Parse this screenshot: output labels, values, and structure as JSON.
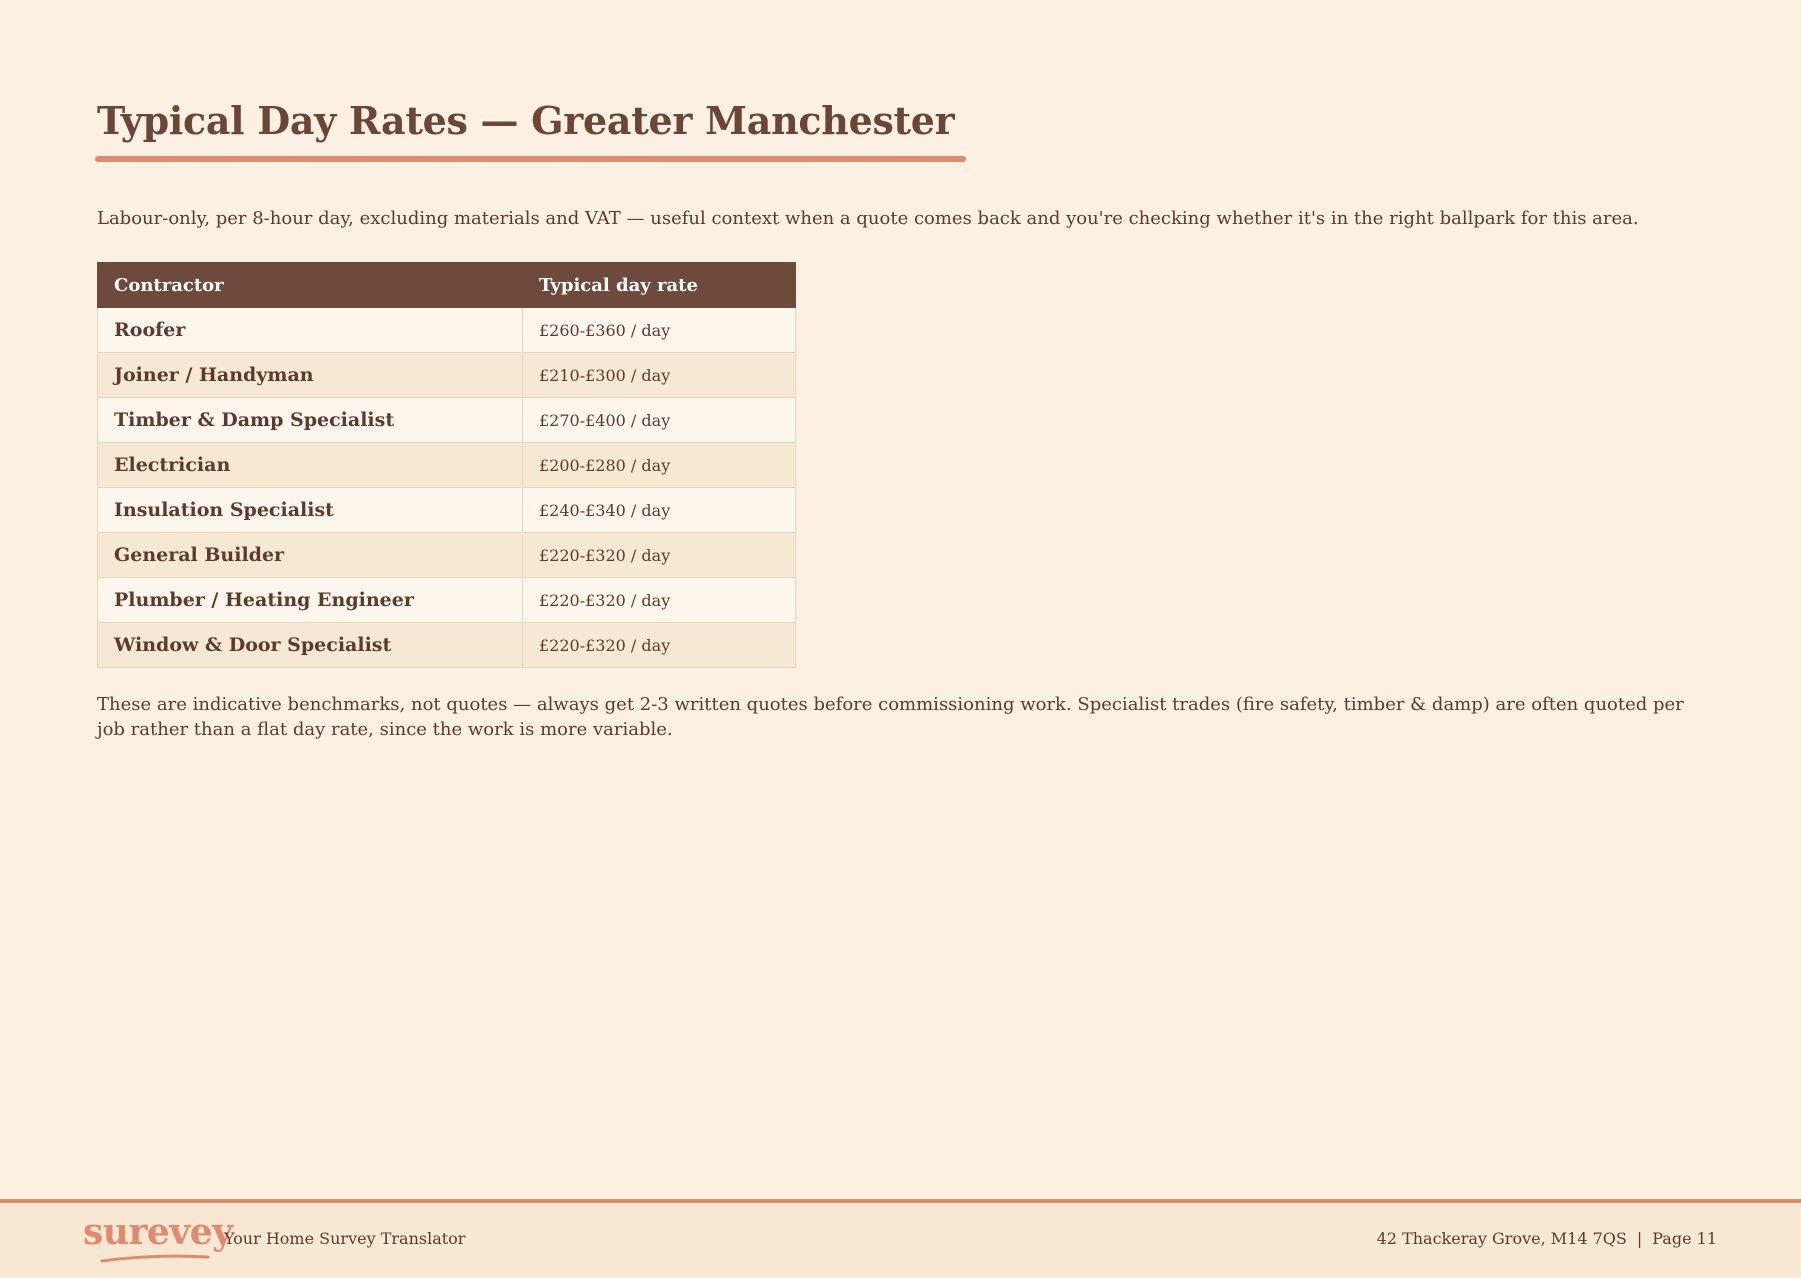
{
  "page": {
    "title": "Typical Day Rates — Greater Manchester",
    "intro": "Labour-only, per 8-hour day, excluding materials and VAT — useful context when a quote comes back and you're checking whether it's in the right ballpark for this area.",
    "note": "These are indicative benchmarks, not quotes — always get 2-3 written quotes before commissioning work. Specialist trades (fire safety, timber & damp) are often quoted per job rather than a flat day rate, since the work is more variable."
  },
  "table": {
    "headers": [
      "Contractor",
      "Typical day rate"
    ],
    "rows": [
      {
        "contractor": "Roofer",
        "rate": "£260-£360 / day"
      },
      {
        "contractor": "Joiner / Handyman",
        "rate": "£210-£300 / day"
      },
      {
        "contractor": "Timber & Damp Specialist",
        "rate": "£270-£400 / day"
      },
      {
        "contractor": "Electrician",
        "rate": "£200-£280 / day"
      },
      {
        "contractor": "Insulation Specialist",
        "rate": "£240-£340 / day"
      },
      {
        "contractor": "General Builder",
        "rate": "£220-£320 / day"
      },
      {
        "contractor": "Plumber / Heating Engineer",
        "rate": "£220-£320 / day"
      },
      {
        "contractor": "Window & Door Specialist",
        "rate": "£220-£320 / day"
      }
    ]
  },
  "footer": {
    "logo": "surevey",
    "tagline": "Your Home Survey Translator",
    "address": "42 Thackeray Grove, M14 7QS",
    "separator": "|",
    "page": "Page 11"
  },
  "colors": {
    "background": "#fbf0e1",
    "accent": "#e08a70",
    "header_bg": "#6e4a3c",
    "text": "#5b3a2f"
  }
}
